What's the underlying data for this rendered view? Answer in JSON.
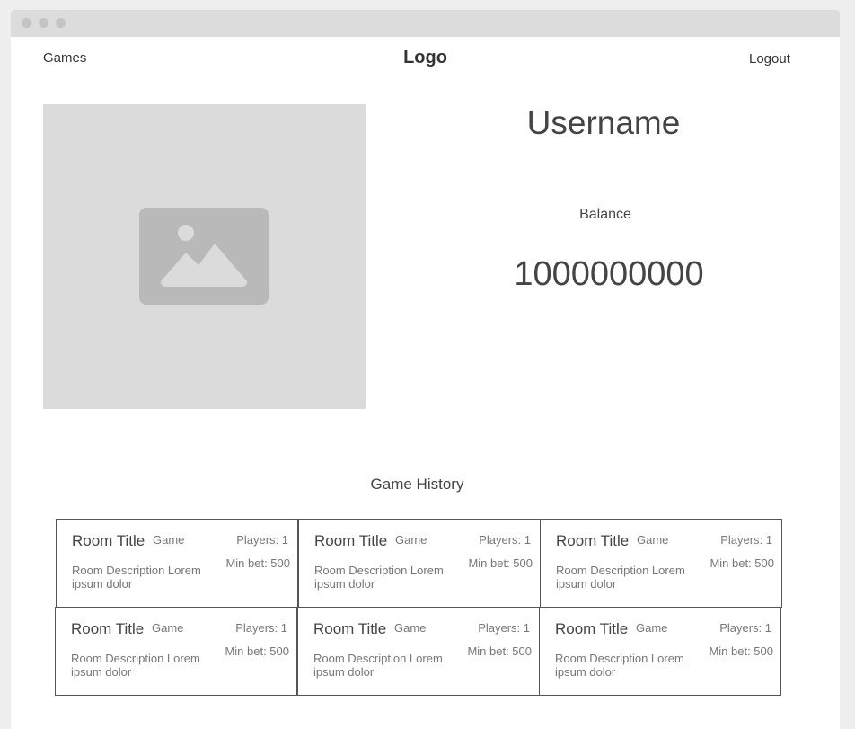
{
  "nav": {
    "games_label": "Games",
    "logo_label": "Logo",
    "logout_label": "Logout"
  },
  "profile": {
    "avatar_icon": "image-placeholder-icon",
    "username": "Username",
    "balance_label": "Balance",
    "balance_value": "1000000000"
  },
  "history": {
    "title": "Game History",
    "rooms": [
      {
        "title": "Room Title",
        "game": "Game",
        "players": "Players: 1",
        "min_bet": "Min bet: 500",
        "description": "Room Description Lorem ipsum dolor"
      },
      {
        "title": "Room Title",
        "game": "Game",
        "players": "Players: 1",
        "min_bet": "Min bet: 500",
        "description": "Room Description Lorem ipsum dolor"
      },
      {
        "title": "Room Title",
        "game": "Game",
        "players": "Players: 1",
        "min_bet": "Min bet: 500",
        "description": "Room Description Lorem ipsum dolor"
      },
      {
        "title": "Room Title",
        "game": "Game",
        "players": "Players: 1",
        "min_bet": "Min bet: 500",
        "description": "Room Description Lorem ipsum dolor"
      },
      {
        "title": "Room Title",
        "game": "Game",
        "players": "Players: 1",
        "min_bet": "Min bet: 500",
        "description": "Room Description Lorem ipsum dolor"
      },
      {
        "title": "Room Title",
        "game": "Game",
        "players": "Players: 1",
        "min_bet": "Min bet: 500",
        "description": "Room Description Lorem ipsum dolor"
      }
    ]
  }
}
